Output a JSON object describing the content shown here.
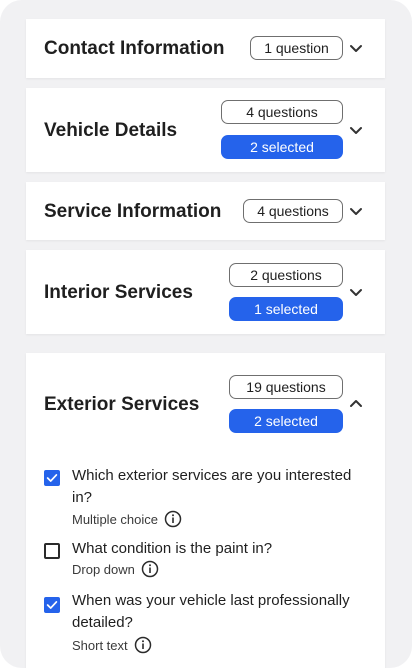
{
  "sections": [
    {
      "title": "Contact Information",
      "questions": "1 question",
      "selected": null,
      "expanded": false
    },
    {
      "title": "Vehicle Details",
      "questions": "4 questions",
      "selected": "2 selected",
      "expanded": false
    },
    {
      "title": "Service Information",
      "questions": "4 questions",
      "selected": null,
      "expanded": false
    },
    {
      "title": "Interior Services",
      "questions": "2 questions",
      "selected": "1 selected",
      "expanded": false
    },
    {
      "title": "Exterior Services",
      "questions": "19 questions",
      "selected": "2 selected",
      "expanded": true
    }
  ],
  "exterior_questions": [
    {
      "text": "Which exterior services are you interested in?",
      "type": "Multiple choice",
      "checked": true
    },
    {
      "text": "What condition is the paint in?",
      "type": "Drop down",
      "checked": false
    },
    {
      "text": "When was your vehicle last professionally detailed?",
      "type": "Short text",
      "checked": true
    }
  ],
  "colors": {
    "accent": "#2563eb",
    "background": "#f1f1f3",
    "card": "#ffffff"
  },
  "icons": {
    "collapsed": "chevron-down-icon",
    "expanded": "chevron-up-icon",
    "info": "info-icon",
    "check": "checkmark-icon"
  }
}
